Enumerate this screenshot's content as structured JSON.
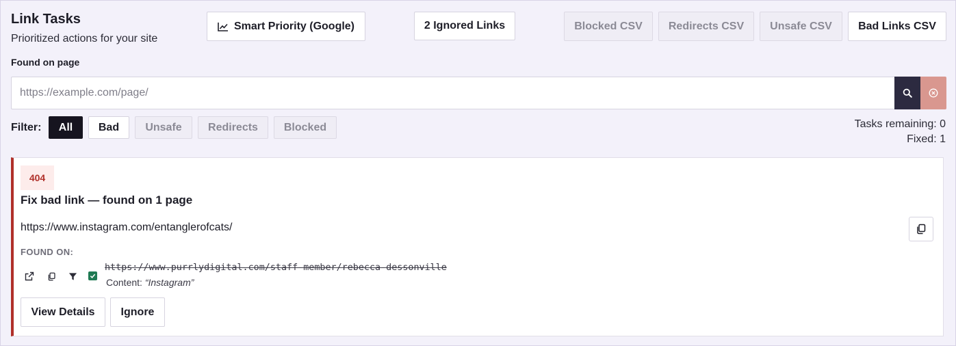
{
  "header": {
    "title": "Link Tasks",
    "subtitle": "Prioritized actions for your site"
  },
  "toolbar": {
    "smart_priority_label": "Smart Priority (Google)",
    "ignored_links_label": "2 Ignored Links",
    "blocked_csv_label": "Blocked CSV",
    "redirects_csv_label": "Redirects CSV",
    "unsafe_csv_label": "Unsafe CSV",
    "bad_links_csv_label": "Bad Links CSV"
  },
  "search": {
    "label": "Found on page",
    "placeholder": "https://example.com/page/",
    "value": ""
  },
  "filter": {
    "label": "Filter:",
    "options": [
      "All",
      "Bad",
      "Unsafe",
      "Redirects",
      "Blocked"
    ],
    "selected": "All"
  },
  "stats": {
    "tasks_remaining": "Tasks remaining: 0",
    "fixed": "Fixed: 1"
  },
  "task": {
    "status_code": "404",
    "title": "Fix bad link — found on 1 page",
    "url": "https://www.instagram.com/entanglerofcats/",
    "found_on_label": "FOUND ON:",
    "pages": [
      {
        "url": "https://www.purrlydigital.com/staff-member/rebecca-dessonville",
        "content_label": "Content:",
        "content_text": "“Instagram”",
        "checked": true
      }
    ],
    "view_details_label": "View Details",
    "ignore_label": "Ignore"
  },
  "colors": {
    "panel_bg": "#f3f1fa",
    "accent_dark": "#16141f",
    "search_button": "#2c2a40",
    "clear_button": "#d9978f",
    "error_red": "#b0302a",
    "check_green": "#1f7a53"
  },
  "icons": {
    "smart_priority": "trend-line-icon",
    "search": "search-icon",
    "clear": "clear-circle-icon",
    "copy": "copy-icon",
    "open": "external-link-icon",
    "filter": "filter-icon",
    "check": "checkbox-checked-icon"
  }
}
